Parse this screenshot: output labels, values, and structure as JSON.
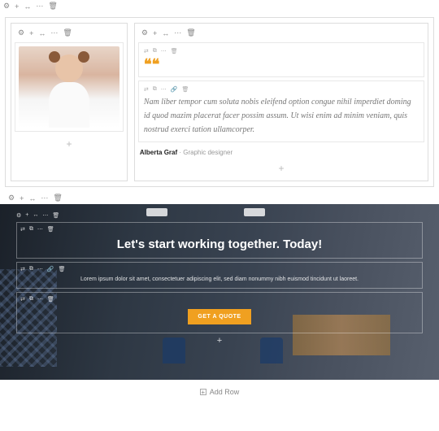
{
  "icons": {
    "gear": "⚙",
    "plus": "+",
    "arrows": "↔",
    "ellipsis": "⋯",
    "trash": "🗑",
    "arrowsalt": "⇄",
    "dup": "⧉",
    "link": "🔗"
  },
  "section1": {
    "col_left": {
      "image_alt": "person-photo"
    },
    "col_right": {
      "quote_mark": "❝❝",
      "quote_text": "Nam liber tempor cum soluta nobis eleifend option congue nihil imperdiet doming id quod mazim placerat facer possim assum. Ut wisi enim ad minim veniam, quis nostrud exerci tation ullamcorper.",
      "author_name": "Alberta Graf",
      "author_sep": " · ",
      "author_role": "Graphic designer"
    }
  },
  "section2": {
    "heading": "Let's start working together. Today!",
    "subtext": "Lorem ipsum dolor sit amet, consectetuer adipiscing elit, sed diam nonummy nibh euismod tincidunt ut laoreet.",
    "button": "GET A QUOTE"
  },
  "footer": {
    "add_row": "Add Row"
  }
}
